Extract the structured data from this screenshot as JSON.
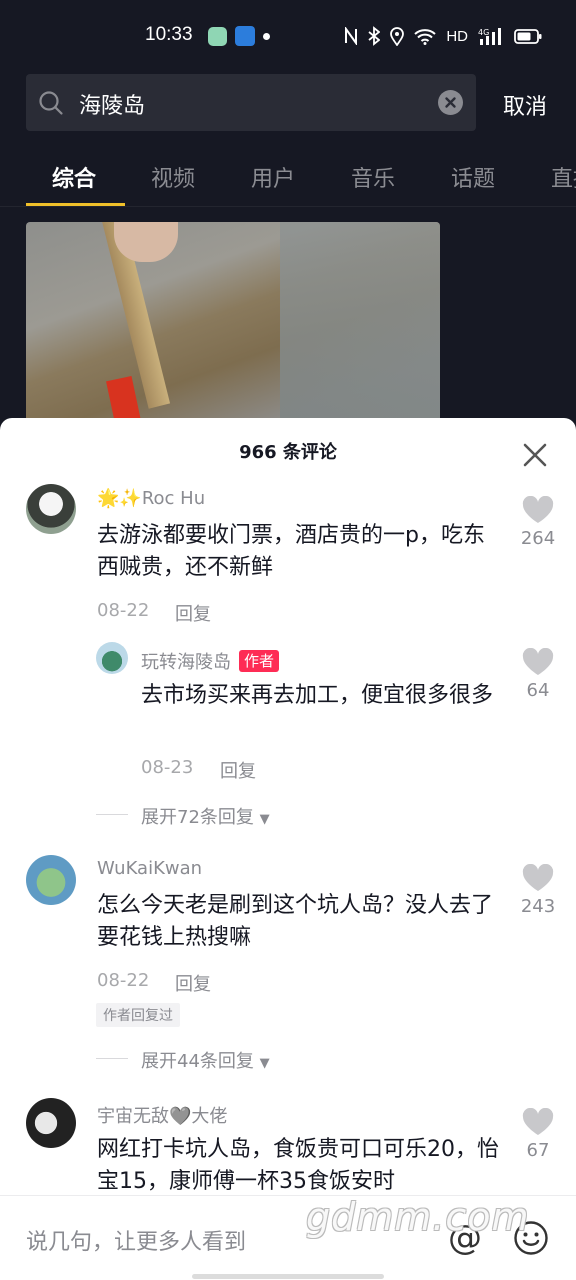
{
  "status_bar": {
    "time": "10:33",
    "network": "HD",
    "icons": [
      "nfc-icon",
      "bluetooth-icon",
      "location-icon",
      "wifi-icon",
      "signal-4g-icon",
      "battery-icon"
    ]
  },
  "search": {
    "query": "海陵岛",
    "cancel_label": "取消"
  },
  "tabs": [
    {
      "label": "综合",
      "active": true
    },
    {
      "label": "视频",
      "active": false
    },
    {
      "label": "用户",
      "active": false
    },
    {
      "label": "音乐",
      "active": false
    },
    {
      "label": "话题",
      "active": false
    },
    {
      "label": "直播",
      "active": false
    }
  ],
  "comments_panel": {
    "title": "966 条评论",
    "comments": [
      {
        "name": "🌟✨Roc Hu",
        "text": "去游泳都要收门票，酒店贵的一p，吃东西贼贵，还不新鲜",
        "date": "08-22",
        "reply_label": "回复",
        "likes": "264",
        "reply": {
          "name": "玩转海陵岛",
          "badge": "作者",
          "text": "去市场买来再去加工，便宜很多很多",
          "date": "08-23",
          "reply_label": "回复",
          "likes": "64"
        },
        "expand_label": "展开72条回复"
      },
      {
        "name": "WuKaiKwan",
        "text": "怎么今天老是刷到这个坑人岛？没人去了要花钱上热搜嘛",
        "date": "08-22",
        "reply_label": "回复",
        "likes": "243",
        "author_replied": "作者回复过",
        "expand_label": "展开44条回复"
      },
      {
        "name": "宇宙无敌🩶大佬",
        "text": "网红打卡坑人岛，食饭贵可口可乐20，怡宝15，康师傅一杯35食饭安时",
        "likes": "67"
      }
    ]
  },
  "input": {
    "placeholder": "说几句，让更多人看到"
  },
  "watermark": "gdmm.com",
  "colors": {
    "background": "#161823",
    "tab_indicator": "#f0c02a",
    "author_badge": "#fe2c55"
  }
}
